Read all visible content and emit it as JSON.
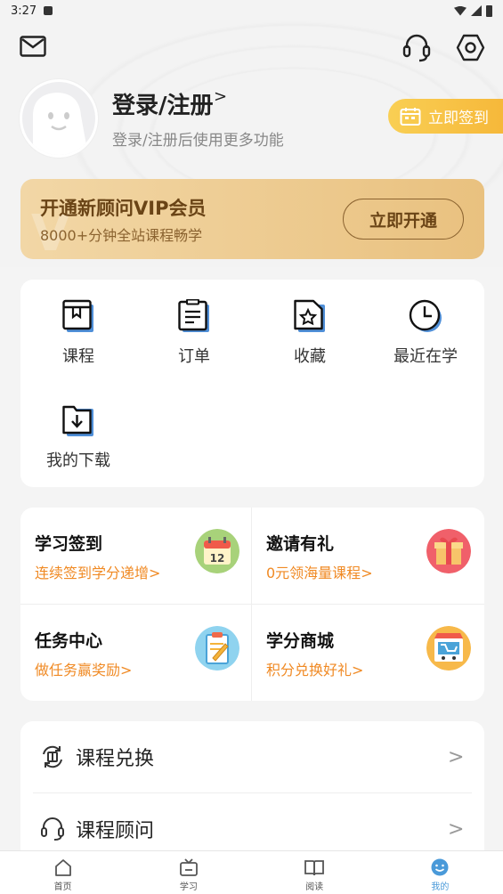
{
  "status_bar": {
    "time": "3:27"
  },
  "header": {
    "login_title": "登录/注册",
    "login_chevron": ">",
    "login_subtitle": "登录/注册后使用更多功能",
    "signin_button": "立即签到"
  },
  "vip": {
    "title": "开通新顾问VIP会员",
    "subtitle": "8000+分钟全站课程畅学",
    "button": "立即开通"
  },
  "menu": {
    "items": [
      {
        "label": "课程",
        "icon": "book-icon"
      },
      {
        "label": "订单",
        "icon": "clipboard-icon"
      },
      {
        "label": "收藏",
        "icon": "star-file-icon"
      },
      {
        "label": "最近在学",
        "icon": "clock-icon"
      },
      {
        "label": "我的下载",
        "icon": "download-folder-icon"
      }
    ]
  },
  "tasks": [
    {
      "title": "学习签到",
      "subtitle": "连续签到学分递增",
      "chevron": ">",
      "icon": "calendar-icon"
    },
    {
      "title": "邀请有礼",
      "subtitle": "0元领海量课程",
      "chevron": ">",
      "icon": "gift-icon"
    },
    {
      "title": "任务中心",
      "subtitle": "做任务赢奖励",
      "chevron": ">",
      "icon": "task-clipboard-icon"
    },
    {
      "title": "学分商城",
      "subtitle": "积分兑换好礼",
      "chevron": ">",
      "icon": "shop-icon"
    }
  ],
  "calendar_day": "12",
  "list": [
    {
      "label": "课程兑换",
      "icon": "exchange-icon",
      "chevron": ">"
    },
    {
      "label": "课程顾问",
      "icon": "headset-icon",
      "chevron": ">"
    }
  ],
  "tabbar": {
    "tabs": [
      {
        "label": "首页",
        "icon": "home-icon"
      },
      {
        "label": "学习",
        "icon": "tv-icon"
      },
      {
        "label": "阅读",
        "icon": "book-open-icon"
      },
      {
        "label": "我的",
        "icon": "smile-icon",
        "active": true
      }
    ]
  },
  "colors": {
    "accent_orange": "#f08a24",
    "signin_yellow": "#f6b83a",
    "vip_gold": "#e9c17f",
    "tab_active": "#4a9ad9",
    "icon_blue": "#4f8fd8"
  }
}
